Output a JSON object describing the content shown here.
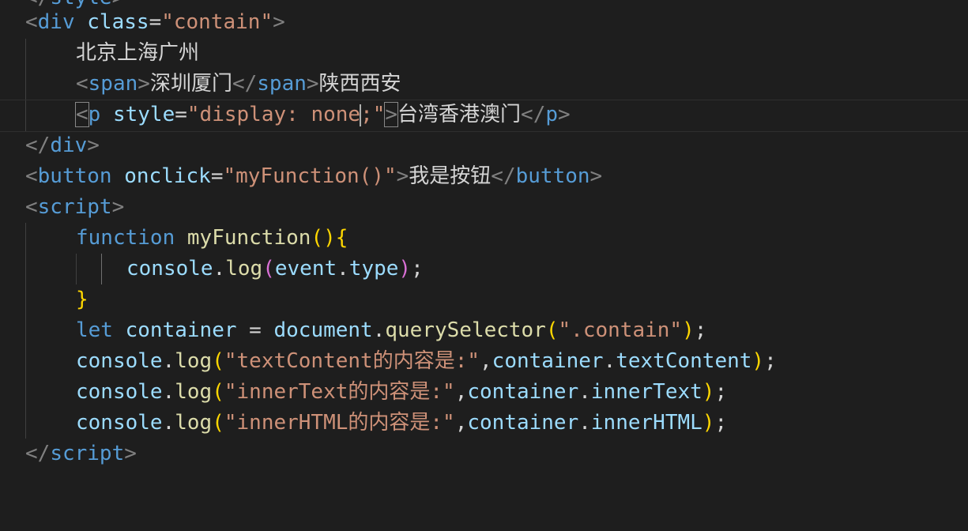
{
  "code": {
    "line0": {
      "lt": "<",
      "tag": "div",
      "attr": "class",
      "eq": "=",
      "str": "\"contain\"",
      "gt": ">"
    },
    "line1": {
      "text": "北京上海广州"
    },
    "line2": {
      "lt": "<",
      "tag": "span",
      "gt": ">",
      "text1": "深圳厦门",
      "lt2": "</",
      "tag2": "span",
      "gt2": ">",
      "text2": "陕西西安"
    },
    "line3": {
      "lt": "<",
      "tag": "p",
      "attr": "style",
      "eq": "=",
      "str1": "\"display: none",
      "str2": ";\"",
      "gt": ">",
      "text": "台湾香港澳门",
      "lt2": "</",
      "tag2": "p",
      "gt2": ">"
    },
    "line4": {
      "lt": "</",
      "tag": "div",
      "gt": ">"
    },
    "line5": {
      "lt": "<",
      "tag": "button",
      "attr": "onclick",
      "eq": "=",
      "str": "\"myFunction()\"",
      "gt": ">",
      "text": "我是按钮",
      "lt2": "</",
      "tag2": "button",
      "gt2": ">"
    },
    "line6": {
      "lt": "<",
      "tag": "script",
      "gt": ">"
    },
    "line7": {
      "kw": "function",
      "fn": "myFunction",
      "br1": "()",
      "br2": "{"
    },
    "line8": {
      "obj": "console",
      "dot": ".",
      "fn": "log",
      "br1": "(",
      "var1": "event",
      "dot2": ".",
      "var2": "type",
      "br2": ")",
      "semi": ";"
    },
    "line9": {
      "br": "}"
    },
    "line10": {
      "kw": "let",
      "var": "container",
      "eq": " = ",
      "obj": "document",
      "dot": ".",
      "fn": "querySelector",
      "br1": "(",
      "str": "\".contain\"",
      "br2": ")",
      "semi": ";"
    },
    "line11": {
      "obj": "console",
      "dot": ".",
      "fn": "log",
      "br1": "(",
      "str": "\"textContent的内容是:\"",
      "comma": ",",
      "var1": "container",
      "dot2": ".",
      "var2": "textContent",
      "br2": ")",
      "semi": ";"
    },
    "line12": {
      "obj": "console",
      "dot": ".",
      "fn": "log",
      "br1": "(",
      "str": "\"innerText的内容是:\"",
      "comma": ",",
      "var1": "container",
      "dot2": ".",
      "var2": "innerText",
      "br2": ")",
      "semi": ";"
    },
    "line13": {
      "obj": "console",
      "dot": ".",
      "fn": "log",
      "br1": "(",
      "str": "\"innerHTML的内容是:\"",
      "comma": ",",
      "var1": "container",
      "dot2": ".",
      "var2": "innerHTML",
      "br2": ")",
      "semi": ";"
    },
    "line14": {
      "lt": "</",
      "tag": "script",
      "gt": ">"
    }
  }
}
